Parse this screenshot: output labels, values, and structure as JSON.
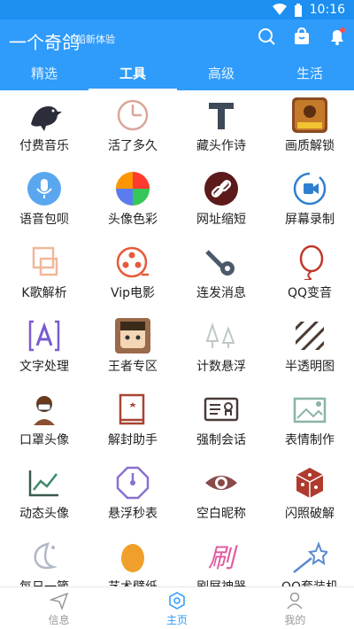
{
  "status": {
    "time": "10:16"
  },
  "header": {
    "title": "一个奇鸽",
    "subtitle": "船新体验"
  },
  "tabs": [
    {
      "label": "精选"
    },
    {
      "label": "工具",
      "active": true
    },
    {
      "label": "高级"
    },
    {
      "label": "生活"
    }
  ],
  "tools": [
    {
      "label": "付费音乐",
      "icon": "bird-icon"
    },
    {
      "label": "活了多久",
      "icon": "pie-timer-icon"
    },
    {
      "label": "藏头作诗",
      "icon": "text-t-icon"
    },
    {
      "label": "画质解锁",
      "icon": "game-cover-icon"
    },
    {
      "label": "语音包呗",
      "icon": "microphone-icon"
    },
    {
      "label": "头像色彩",
      "icon": "color-wheel-icon"
    },
    {
      "label": "网址缩短",
      "icon": "link-icon"
    },
    {
      "label": "屏幕录制",
      "icon": "screen-record-icon"
    },
    {
      "label": "K歌解析",
      "icon": "crop-icon"
    },
    {
      "label": "Vip电影",
      "icon": "film-reel-icon"
    },
    {
      "label": "连发消息",
      "icon": "wrench-gear-icon"
    },
    {
      "label": "QQ变音",
      "icon": "balloon-icon"
    },
    {
      "label": "文字处理",
      "icon": "text-a-icon"
    },
    {
      "label": "王者专区",
      "icon": "hero-avatar-icon"
    },
    {
      "label": "计数悬浮",
      "icon": "trees-icon"
    },
    {
      "label": "半透明图",
      "icon": "stripes-icon"
    },
    {
      "label": "口罩头像",
      "icon": "mask-person-icon"
    },
    {
      "label": "解封助手",
      "icon": "book-star-icon"
    },
    {
      "label": "强制会话",
      "icon": "id-card-icon"
    },
    {
      "label": "表情制作",
      "icon": "picture-icon"
    },
    {
      "label": "动态头像",
      "icon": "line-chart-icon"
    },
    {
      "label": "悬浮秒表",
      "icon": "octagon-clock-icon"
    },
    {
      "label": "空白昵称",
      "icon": "eye-icon"
    },
    {
      "label": "闪照破解",
      "icon": "dice-icon"
    },
    {
      "label": "每日一箴",
      "icon": "moon-icon"
    },
    {
      "label": "艺术壁纸",
      "icon": "egg-icon"
    },
    {
      "label": "刷屏神器",
      "icon": "brush-text-icon"
    },
    {
      "label": "QQ套装机",
      "icon": "shooting-star-icon"
    }
  ],
  "bottom_nav": [
    {
      "label": "信息",
      "icon": "send-icon"
    },
    {
      "label": "主页",
      "icon": "home-hex-icon",
      "active": true
    },
    {
      "label": "我的",
      "icon": "user-icon"
    }
  ],
  "colors": {
    "primary": "#2f9bfa",
    "statusbar": "#1c8ff0"
  }
}
